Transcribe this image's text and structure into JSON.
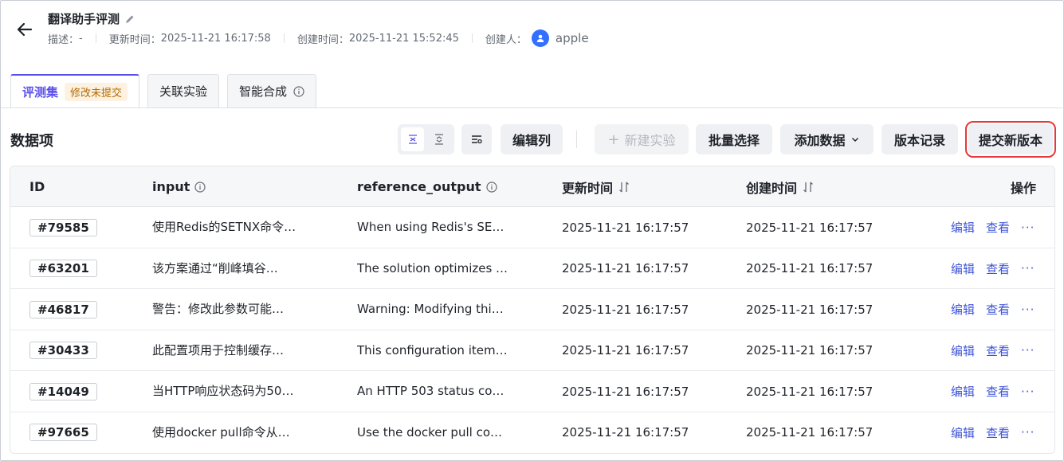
{
  "header": {
    "title": "翻译助手评测",
    "desc_label": "描述：",
    "desc_value": "-",
    "updated_label": "更新时间：",
    "updated_value": "2025-11-21 16:17:58",
    "created_label": "创建时间：",
    "created_value": "2025-11-21 15:52:45",
    "creator_label": "创建人：",
    "creator_name": "apple"
  },
  "tabs": [
    {
      "label": "评测集",
      "badge": "修改未提交"
    },
    {
      "label": "关联实验"
    },
    {
      "label": "智能合成"
    }
  ],
  "section_title": "数据项",
  "toolbar": {
    "edit_columns": "编辑列",
    "new_experiment": "新建实验",
    "batch_select": "批量选择",
    "add_data": "添加数据",
    "version_history": "版本记录",
    "submit_version": "提交新版本"
  },
  "table": {
    "columns": [
      "ID",
      "input",
      "reference_output",
      "更新时间",
      "创建时间",
      "操作"
    ],
    "rows": [
      {
        "id": "#79585",
        "input": "使用Redis的SETNX命令…",
        "output": "When using Redis's SE…",
        "updated": "2025-11-21 16:17:57",
        "created": "2025-11-21 16:17:57"
      },
      {
        "id": "#63201",
        "input": "该方案通过“削峰填谷…",
        "output": "The solution optimizes …",
        "updated": "2025-11-21 16:17:57",
        "created": "2025-11-21 16:17:57"
      },
      {
        "id": "#46817",
        "input": "警告：修改此参数可能…",
        "output": "Warning: Modifying thi…",
        "updated": "2025-11-21 16:17:57",
        "created": "2025-11-21 16:17:57"
      },
      {
        "id": "#30433",
        "input": "此配置项用于控制缓存…",
        "output": "This configuration item…",
        "updated": "2025-11-21 16:17:57",
        "created": "2025-11-21 16:17:57"
      },
      {
        "id": "#14049",
        "input": "当HTTP响应状态码为50…",
        "output": "An HTTP 503 status cod…",
        "updated": "2025-11-21 16:17:57",
        "created": "2025-11-21 16:17:57"
      },
      {
        "id": "#97665",
        "input": "使用docker pull命令从…",
        "output": "Use the docker pull co…",
        "updated": "2025-11-21 16:17:57",
        "created": "2025-11-21 16:17:57"
      }
    ],
    "action_edit": "编辑",
    "action_view": "查看",
    "action_more": "···"
  },
  "colors": {
    "accent": "#5b4fe9",
    "link": "#3f55d6",
    "highlight_border": "#e5393b",
    "badge_bg": "#fdf2e1",
    "badge_text": "#b26a00"
  }
}
